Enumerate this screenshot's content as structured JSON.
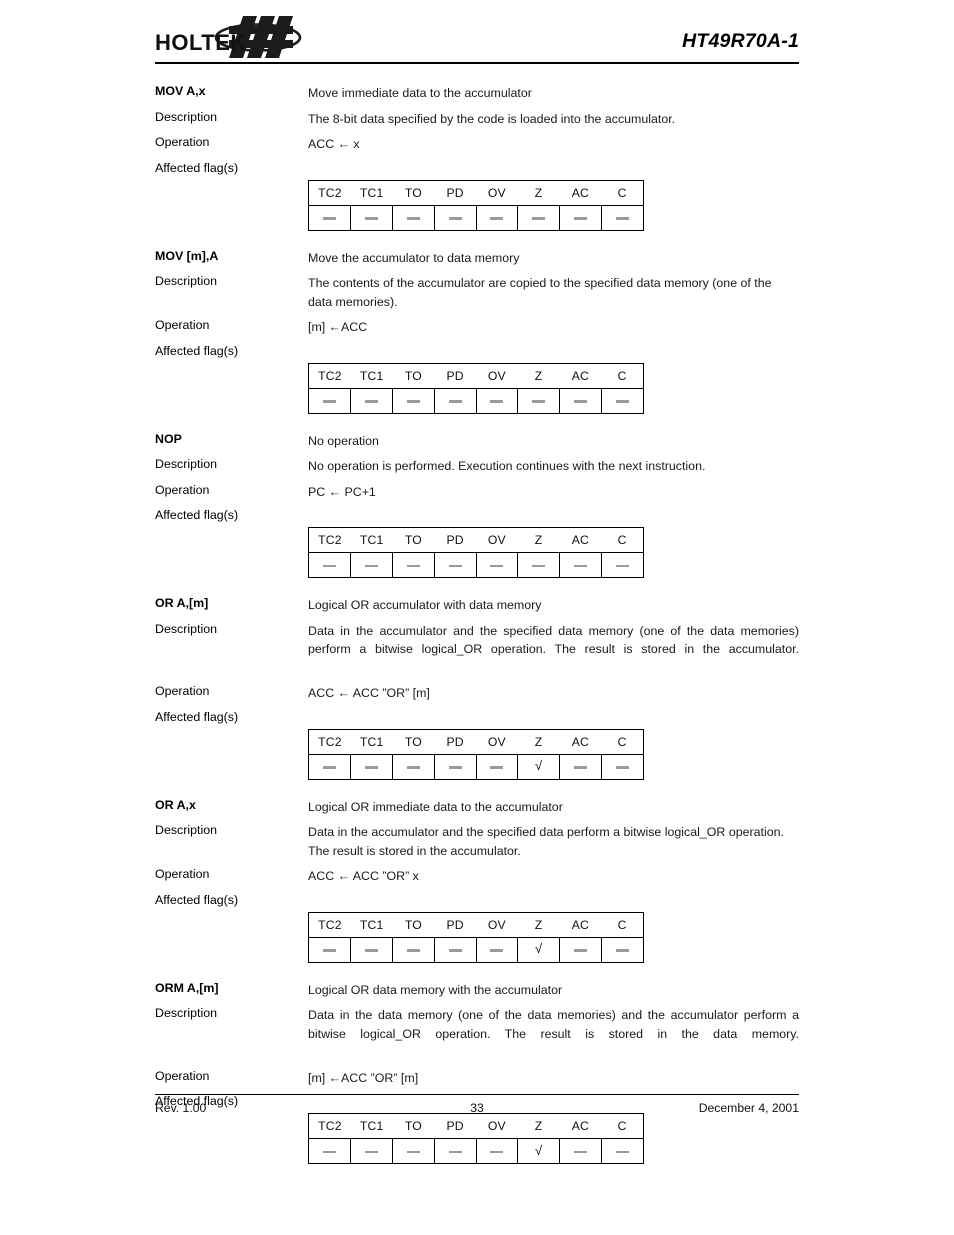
{
  "header": {
    "logo_text": "HOLTEK",
    "logo_icon": "holtek-swoosh-logo",
    "doc_title": "HT49R70A-1"
  },
  "labels": {
    "description": "Description",
    "operation": "Operation",
    "affected_flags": "Affected flag(s)"
  },
  "flag_table": {
    "columns": [
      "TC2",
      "TC1",
      "TO",
      "PD",
      "OV",
      "Z",
      "AC",
      "C"
    ],
    "dash_symbol": "—",
    "check_symbol": "√"
  },
  "instructions": [
    {
      "mnemonic": "MOV A,x",
      "summary": "Move immediate data to the accumulator",
      "description": "The 8-bit data specified by the code is loaded into the accumulator.",
      "operation": "ACC ← x",
      "justified": false,
      "flags": [
        "-",
        "-",
        "-",
        "-",
        "-",
        "-",
        "-",
        "-"
      ]
    },
    {
      "mnemonic": "MOV [m],A",
      "summary": "Move the accumulator to data memory",
      "description": "The contents of the accumulator are copied to the specified data memory (one of the data memories).",
      "operation": "[m] ←ACC",
      "justified": false,
      "flags": [
        "-",
        "-",
        "-",
        "-",
        "-",
        "-",
        "-",
        "-"
      ]
    },
    {
      "mnemonic": "NOP",
      "summary": "No operation",
      "description": "No operation is performed. Execution continues with the next instruction.",
      "operation": "PC ← PC+1",
      "justified": false,
      "flags": [
        "-",
        "-",
        "-",
        "-",
        "-",
        "-",
        "-",
        "-"
      ]
    },
    {
      "mnemonic": "OR A,[m]",
      "summary": "Logical OR accumulator with data memory",
      "description": "Data in the accumulator and the specified data memory (one of the data memories) perform a bitwise logical_OR operation. The result is stored in the accumulator.",
      "operation": "ACC ← ACC ”OR” [m]",
      "justified": true,
      "flags": [
        "-",
        "-",
        "-",
        "-",
        "-",
        "check",
        "-",
        "-"
      ]
    },
    {
      "mnemonic": "OR A,x",
      "summary": "Logical OR immediate data to the accumulator",
      "description": "Data in the accumulator and the specified data perform a bitwise logical_OR operation. The result is stored in the accumulator.",
      "operation": "ACC ← ACC ”OR” x",
      "justified": false,
      "flags": [
        "-",
        "-",
        "-",
        "-",
        "-",
        "check",
        "-",
        "-"
      ]
    },
    {
      "mnemonic": "ORM A,[m]",
      "summary": "Logical OR data memory with the accumulator",
      "description": "Data in the data memory (one of the data memories) and the accumulator perform a bitwise logical_OR operation. The result is stored in the data memory.",
      "operation": "[m] ←ACC ”OR” [m]",
      "justified": true,
      "flags": [
        "-",
        "-",
        "-",
        "-",
        "-",
        "check",
        "-",
        "-"
      ]
    }
  ],
  "footer": {
    "revision": "Rev. 1.00",
    "page_number": "33",
    "date": "December 4, 2001"
  }
}
